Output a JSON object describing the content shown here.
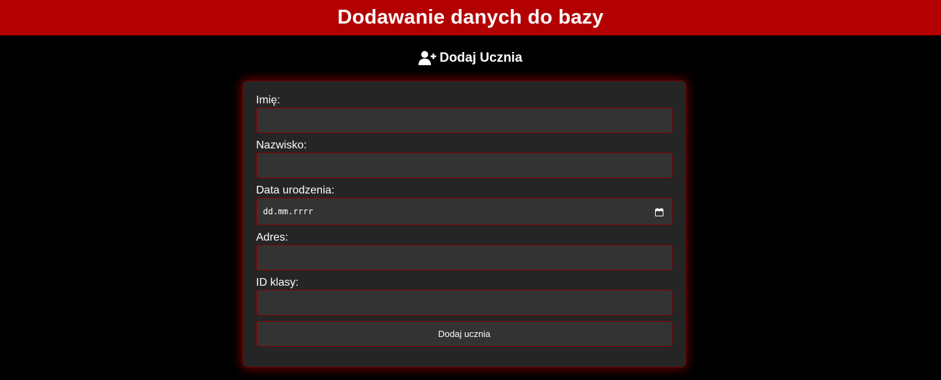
{
  "header": {
    "title": "Dodawanie danych do bazy"
  },
  "section": {
    "title": "Dodaj Ucznia",
    "icon": "user-plus-icon"
  },
  "form": {
    "fields": [
      {
        "label": "Imię:",
        "value": ""
      },
      {
        "label": "Nazwisko:",
        "value": ""
      },
      {
        "label": "Data urodzenia:",
        "value": "",
        "placeholder": "dd.mm.rrrr",
        "icon": "calendar-icon"
      },
      {
        "label": "Adres:",
        "value": ""
      },
      {
        "label": "ID klasy:",
        "value": ""
      }
    ],
    "submit_label": "Dodaj ucznia"
  },
  "colors": {
    "banner": "#b30000",
    "background": "#000000",
    "card": "#252525",
    "input": "#333333",
    "border": "#8b0000"
  }
}
